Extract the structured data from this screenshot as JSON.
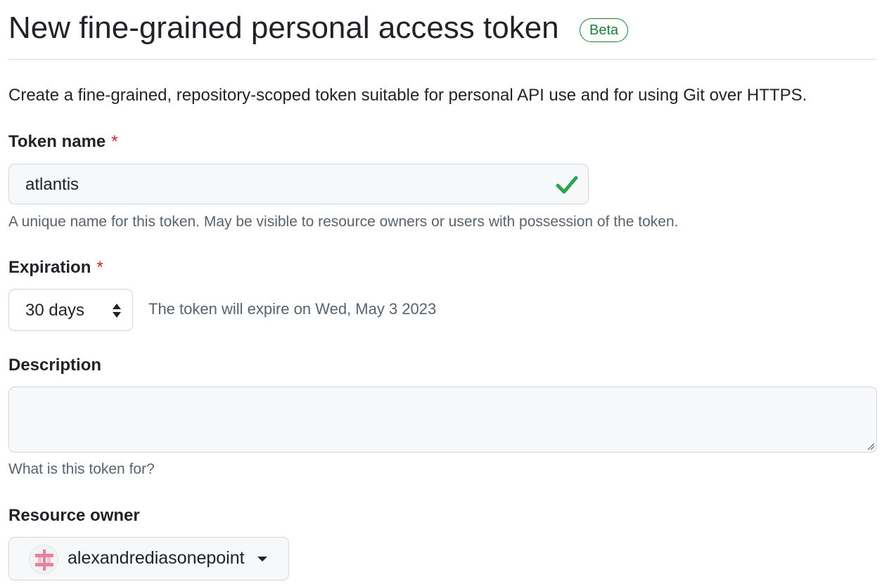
{
  "header": {
    "title": "New fine-grained personal access token",
    "badge": "Beta"
  },
  "intro": "Create a fine-grained, repository-scoped token suitable for personal API use and for using Git over HTTPS.",
  "token_name": {
    "label": "Token name",
    "required_mark": "*",
    "value": "atlantis",
    "valid": true,
    "help": "A unique name for this token. May be visible to resource owners or users with possession of the token."
  },
  "expiration": {
    "label": "Expiration",
    "required_mark": "*",
    "selected": "30 days",
    "note": "The token will expire on Wed, May 3 2023"
  },
  "description": {
    "label": "Description",
    "value": "",
    "help": "What is this token for?"
  },
  "resource_owner": {
    "label": "Resource owner",
    "selected": "alexandrediasonepoint"
  },
  "colors": {
    "success": "#1a7f37",
    "check": "#2da44e",
    "required": "#cf222e",
    "muted": "#59636e",
    "border": "#d0d7de"
  },
  "icons": {
    "valid": "check-icon",
    "select": "up-down-arrows-icon",
    "dropdown": "caret-down-icon",
    "resize": "resize-handle-icon"
  }
}
